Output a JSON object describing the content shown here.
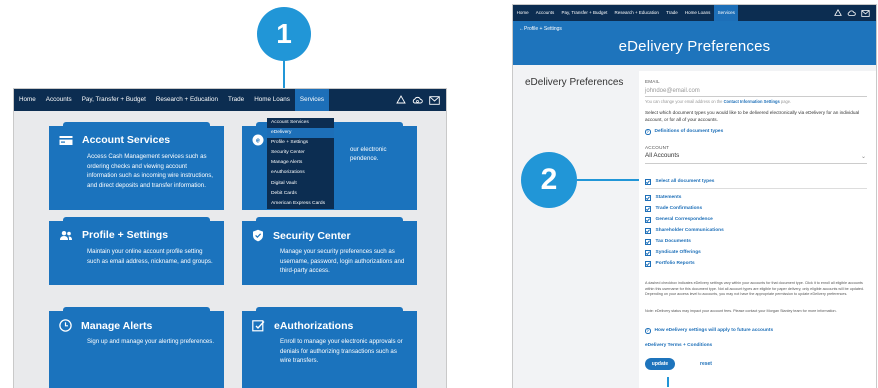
{
  "callouts": {
    "one": "1",
    "two": "2"
  },
  "left": {
    "nav": {
      "items": [
        "Home",
        "Accounts",
        "Pay, Transfer + Budget",
        "Research + Education",
        "Trade",
        "Home Loans",
        "Services"
      ],
      "active": "Services"
    },
    "services_menu": {
      "items": [
        "Account Services",
        "eDelivery",
        "Profile + Settings",
        "Security Center",
        "Manage Alerts",
        "eAuthorizations",
        "Digital Vault",
        "Debit Cards",
        "American Express Cards"
      ],
      "active": "eDelivery"
    },
    "tiles": {
      "account_services": {
        "title": "Account Services",
        "desc": "Access Cash Management services such as ordering checks and viewing account information such as incoming wire instructions, and direct deposits and transfer information."
      },
      "edelivery": {
        "desc_line1": "our electronic",
        "desc_line2": "pendence."
      },
      "profile": {
        "title": "Profile + Settings",
        "desc": "Maintain your online account profile setting such as email address, nickname, and groups."
      },
      "security": {
        "title": "Security Center",
        "desc": "Manage your security preferences such as username, password, login authorizations and third-party access."
      },
      "alerts": {
        "title": "Manage Alerts",
        "desc": "Sign up and manage your alerting preferences."
      },
      "eauth": {
        "title": "eAuthorizations",
        "desc": "Enroll to manage your electronic approvals or denials for authorizing transactions such as wire transfers."
      }
    }
  },
  "right": {
    "nav": {
      "items": [
        "Home",
        "Accounts",
        "Pay, Transfer + Budget",
        "Research + Education",
        "Trade",
        "Home Loans",
        "Services"
      ],
      "active": "Services"
    },
    "back_link": "Profile + Settings",
    "banner_title": "eDelivery Preferences",
    "side_heading": "eDelivery Preferences",
    "email_label": "EMAIL",
    "email_value": "johndoe@email.com",
    "email_hint_pre": "You can change your email address on the ",
    "email_hint_link": "Contact Information Settings",
    "email_hint_post": " page.",
    "select_text": "Select which document types you would like to be delivered electronically via eDelivery for an individual account, or for all of your accounts.",
    "definitions_link": "Definitions of document types",
    "account_label": "ACCOUNT",
    "account_value": "All Accounts",
    "select_all": "Select all document types",
    "doc_types": [
      "Statements",
      "Trade Confirmations",
      "General Correspondence",
      "Shareholder Communications",
      "Tax Documents",
      "Syndicate Offerings",
      "Portfolio Reports"
    ],
    "note1": "A dashed checkbox indicates eDelivery settings vary within your accounts for that document type. Click it to enroll all eligible accounts within this username for this document type. Not all account types are eligible for paper delivery, only eligible accounts will be updated. Depending on your access level to accounts, you may not have the appropriate permission to update eDelivery preferences.",
    "note2": "Note: eDelivery status may impact your account fees. Please contact your Morgan Stanley team for more information.",
    "future_link": "How eDelivery settings will apply to future accounts",
    "terms_link": "eDelivery Terms + Conditions",
    "update_label": "update",
    "reset_label": "reset"
  },
  "colors": {
    "nav_bg": "#0c2d51",
    "tile_blue": "#1b73bd",
    "callout_blue": "#2196d7",
    "link_blue": "#1d6fb8"
  }
}
